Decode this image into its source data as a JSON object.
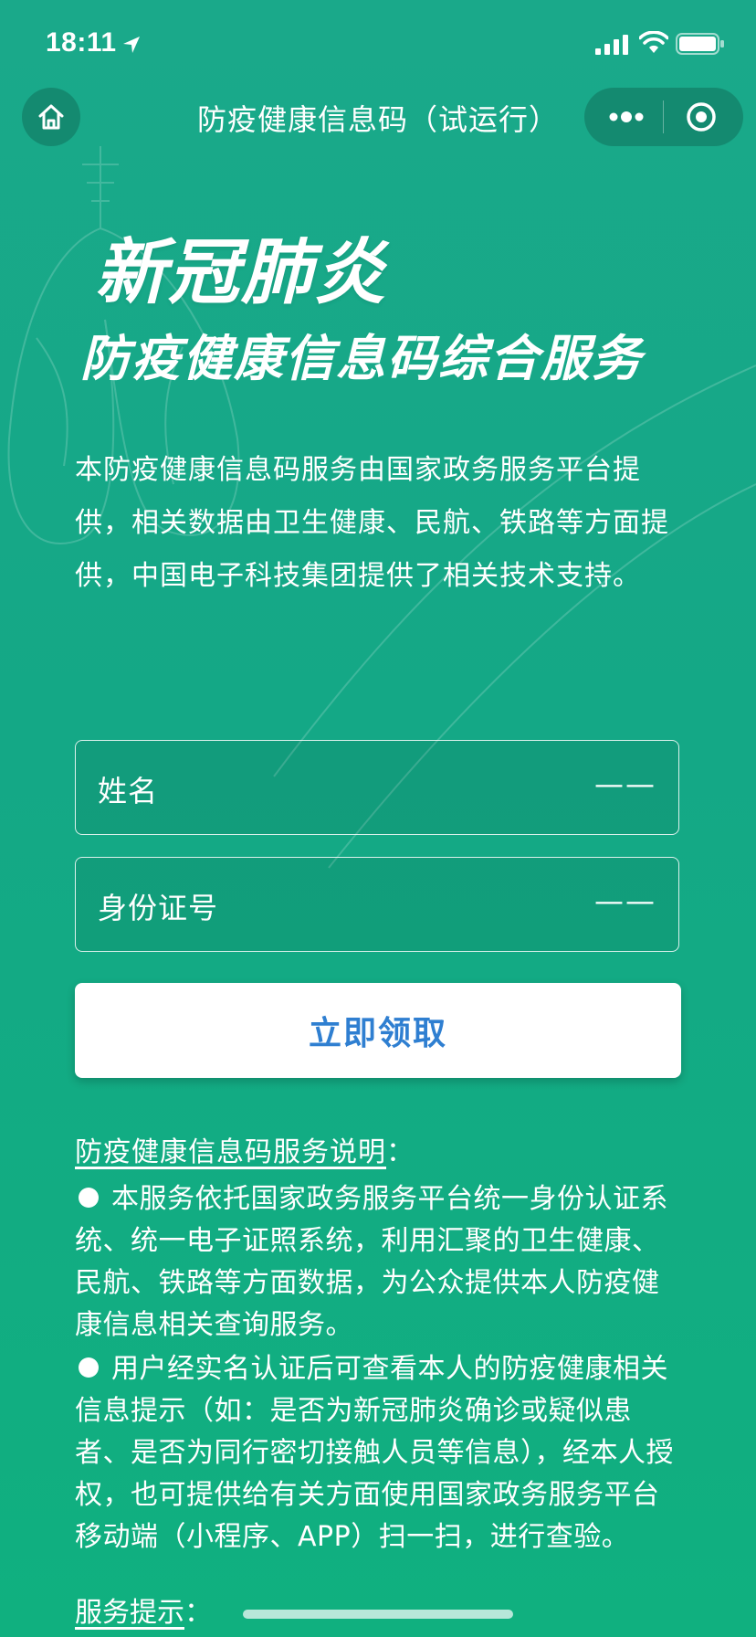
{
  "status_bar": {
    "time": "18:11"
  },
  "nav": {
    "title": "防疫健康信息码（试运行）"
  },
  "hero": {
    "title": "新冠肺炎",
    "subtitle": "防疫健康信息码综合服务"
  },
  "intro_text": "本防疫健康信息码服务由国家政务服务平台提供，相关数据由卫生健康、民航、铁路等方面提供，中国电子科技集团提供了相关技术支持。",
  "form": {
    "name_label": "姓名",
    "name_placeholder": "——",
    "id_label": "身份证号",
    "id_placeholder": "——",
    "submit_label": "立即领取"
  },
  "description": {
    "heading": "防疫健康信息码服务说明",
    "colon": "：",
    "items": [
      "本服务依托国家政务服务平台统一身份认证系统、统一电子证照系统，利用汇聚的卫生健康、民航、铁路等方面数据，为公众提供本人防疫健康信息相关查询服务。",
      "用户经实名认证后可查看本人的防疫健康相关信息提示（如：是否为新冠肺炎确诊或疑似患者、是否为同行密切接触人员等信息），经本人授权，也可提供给有关方面使用国家政务服务平台移动端（小程序、APP）扫一扫，进行查验。"
    ]
  },
  "tips": {
    "heading": "服务提示",
    "colon": "："
  }
}
